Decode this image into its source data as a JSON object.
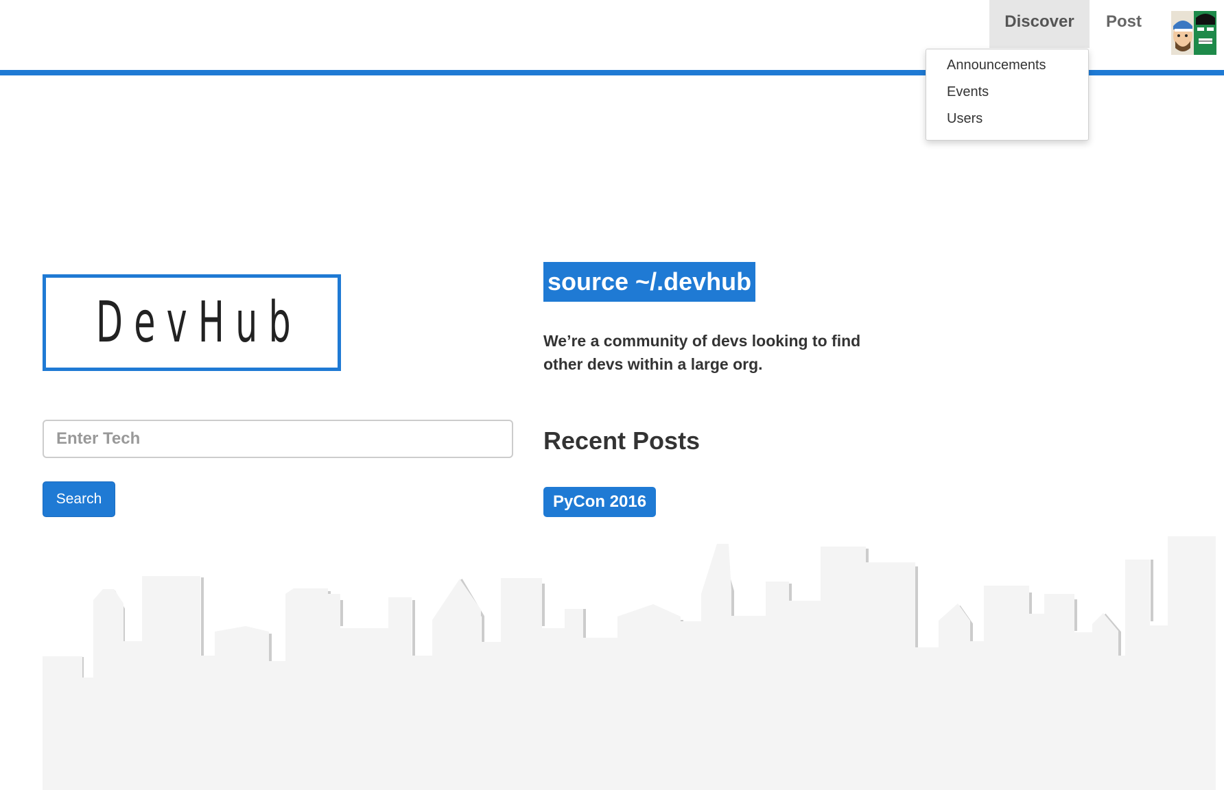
{
  "nav": {
    "discover_label": "Discover",
    "post_label": "Post",
    "avatar_alt": "User avatar"
  },
  "dropdown": {
    "items": [
      "Announcements",
      "Events",
      "Users"
    ]
  },
  "logo": {
    "text": "DevHub"
  },
  "search": {
    "placeholder": "Enter Tech",
    "value": "",
    "button_label": "Search"
  },
  "hero": {
    "tagline": "source ~/.devhub",
    "description": "We’re a community of devs looking to find other devs within a large org."
  },
  "recent_posts": {
    "heading": "Recent Posts",
    "items": [
      "PyCon 2016"
    ]
  },
  "colors": {
    "accent": "#1f7ad4",
    "skyline": "#f4f4f4",
    "skyline_shadow": "#cccccc"
  }
}
